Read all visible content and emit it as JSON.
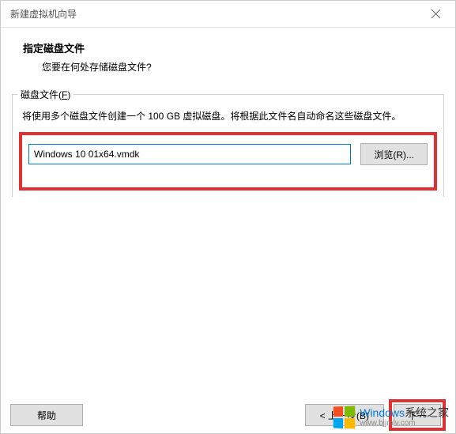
{
  "window": {
    "title": "新建虚拟机向导"
  },
  "header": {
    "title": "指定磁盘文件",
    "subtitle": "您要在何处存储磁盘文件?"
  },
  "fieldset": {
    "legend_prefix": "磁盘文件(",
    "legend_key": "F",
    "legend_suffix": ")",
    "description": "将使用多个磁盘文件创建一个 100 GB 虚拟磁盘。将根据此文件名自动命名这些磁盘文件。"
  },
  "disk": {
    "value": "Windows 10 01x64.vmdk"
  },
  "buttons": {
    "browse": "浏览(R)...",
    "help": "帮助",
    "back": "< 上一步(B)",
    "next": "下一"
  },
  "watermark": {
    "brand_en": "Windows",
    "brand_cn": "系统之家",
    "url": "www.bjjmlv.com"
  }
}
